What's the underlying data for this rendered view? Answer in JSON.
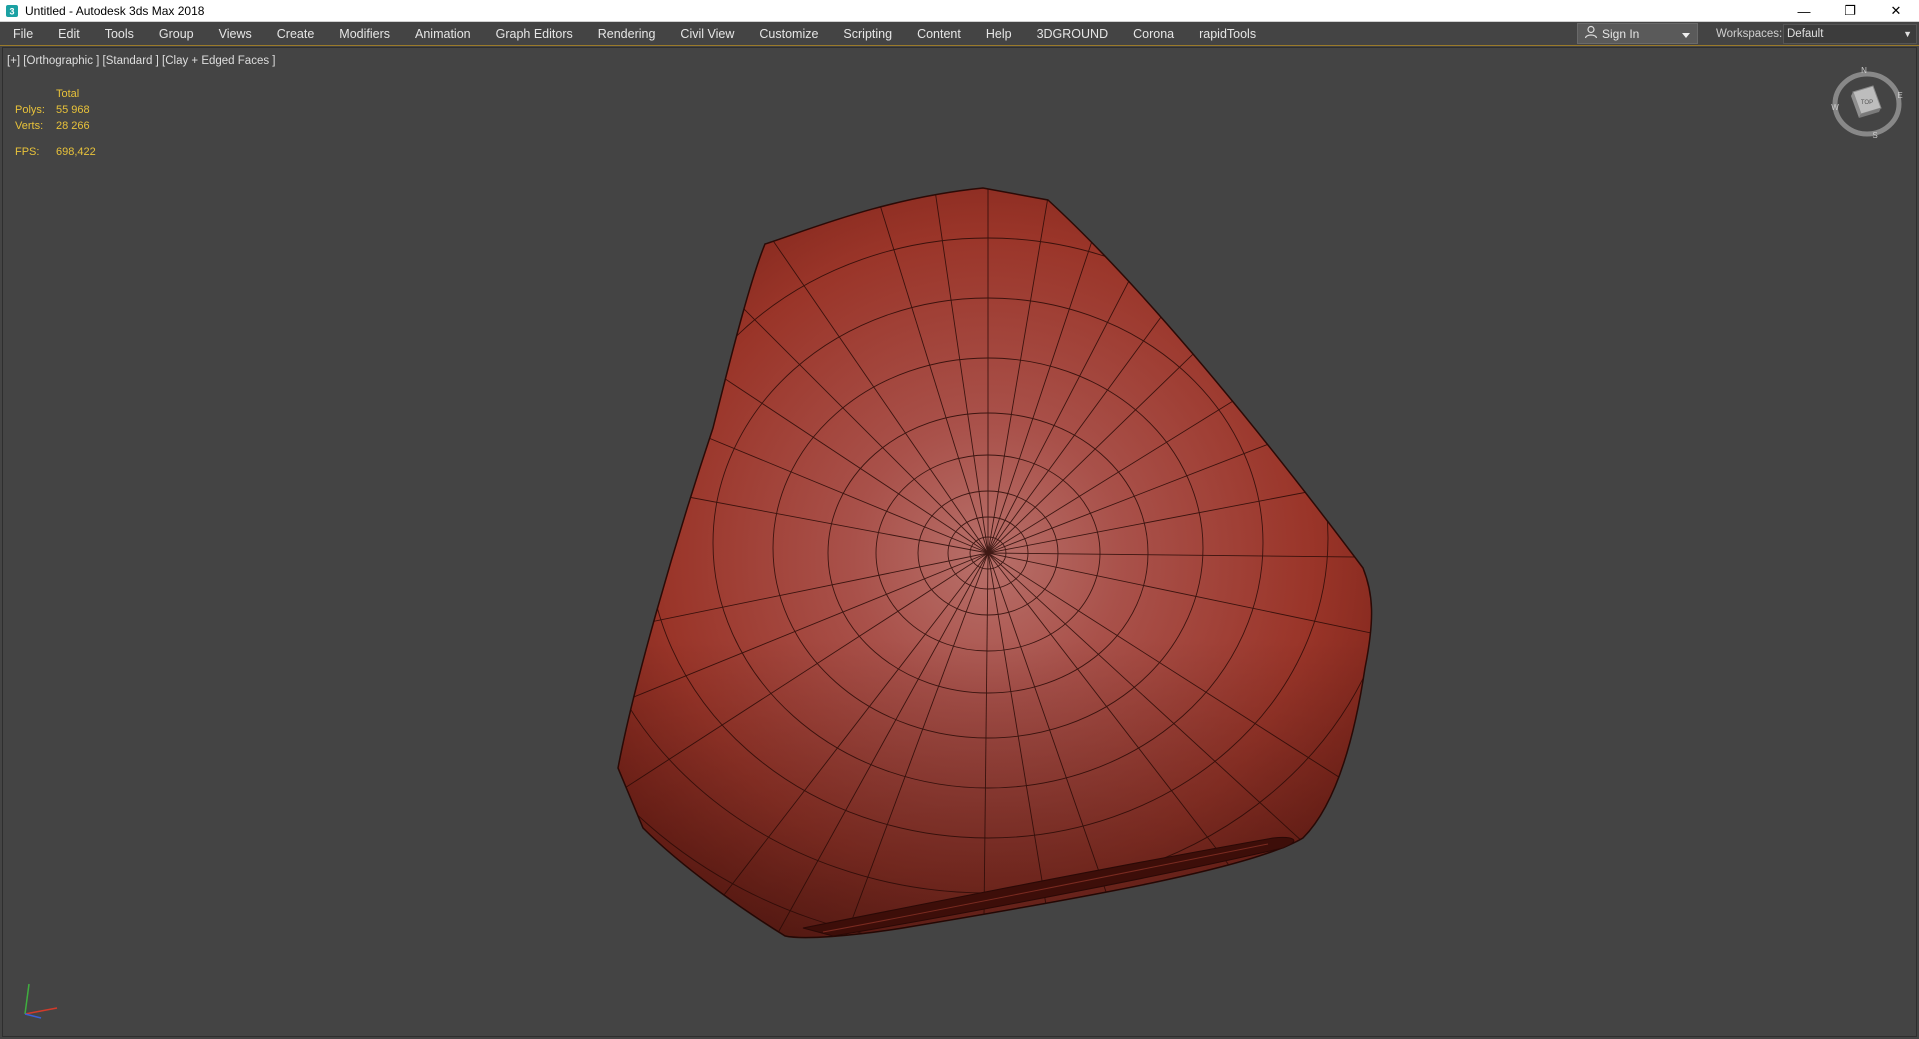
{
  "window": {
    "title": "Untitled - Autodesk 3ds Max 2018",
    "controls": [
      "—",
      "❐",
      "✕"
    ]
  },
  "menu": {
    "items": [
      "File",
      "Edit",
      "Tools",
      "Group",
      "Views",
      "Create",
      "Modifiers",
      "Animation",
      "Graph Editors",
      "Rendering",
      "Civil View",
      "Customize",
      "Scripting",
      "Content",
      "Help",
      "3DGROUND",
      "Corona",
      "rapidTools"
    ]
  },
  "account": {
    "sign_in_label": "Sign In"
  },
  "workspaces": {
    "label": "Workspaces:",
    "value": "Default"
  },
  "viewport": {
    "label": "[+] [Orthographic ] [Standard ] [Clay + Edged Faces ]",
    "stats": {
      "header": "Total",
      "polys_label": "Polys:",
      "polys_value": "55 968",
      "verts_label": "Verts:",
      "verts_value": "28 266",
      "fps_label": "FPS:",
      "fps_value": "698,422"
    },
    "viewcube": {
      "face_label": "TOP",
      "north": "N",
      "south": "S",
      "west": "W",
      "east": "E"
    },
    "object_color": "#b0382e",
    "background_color": "#444444"
  }
}
